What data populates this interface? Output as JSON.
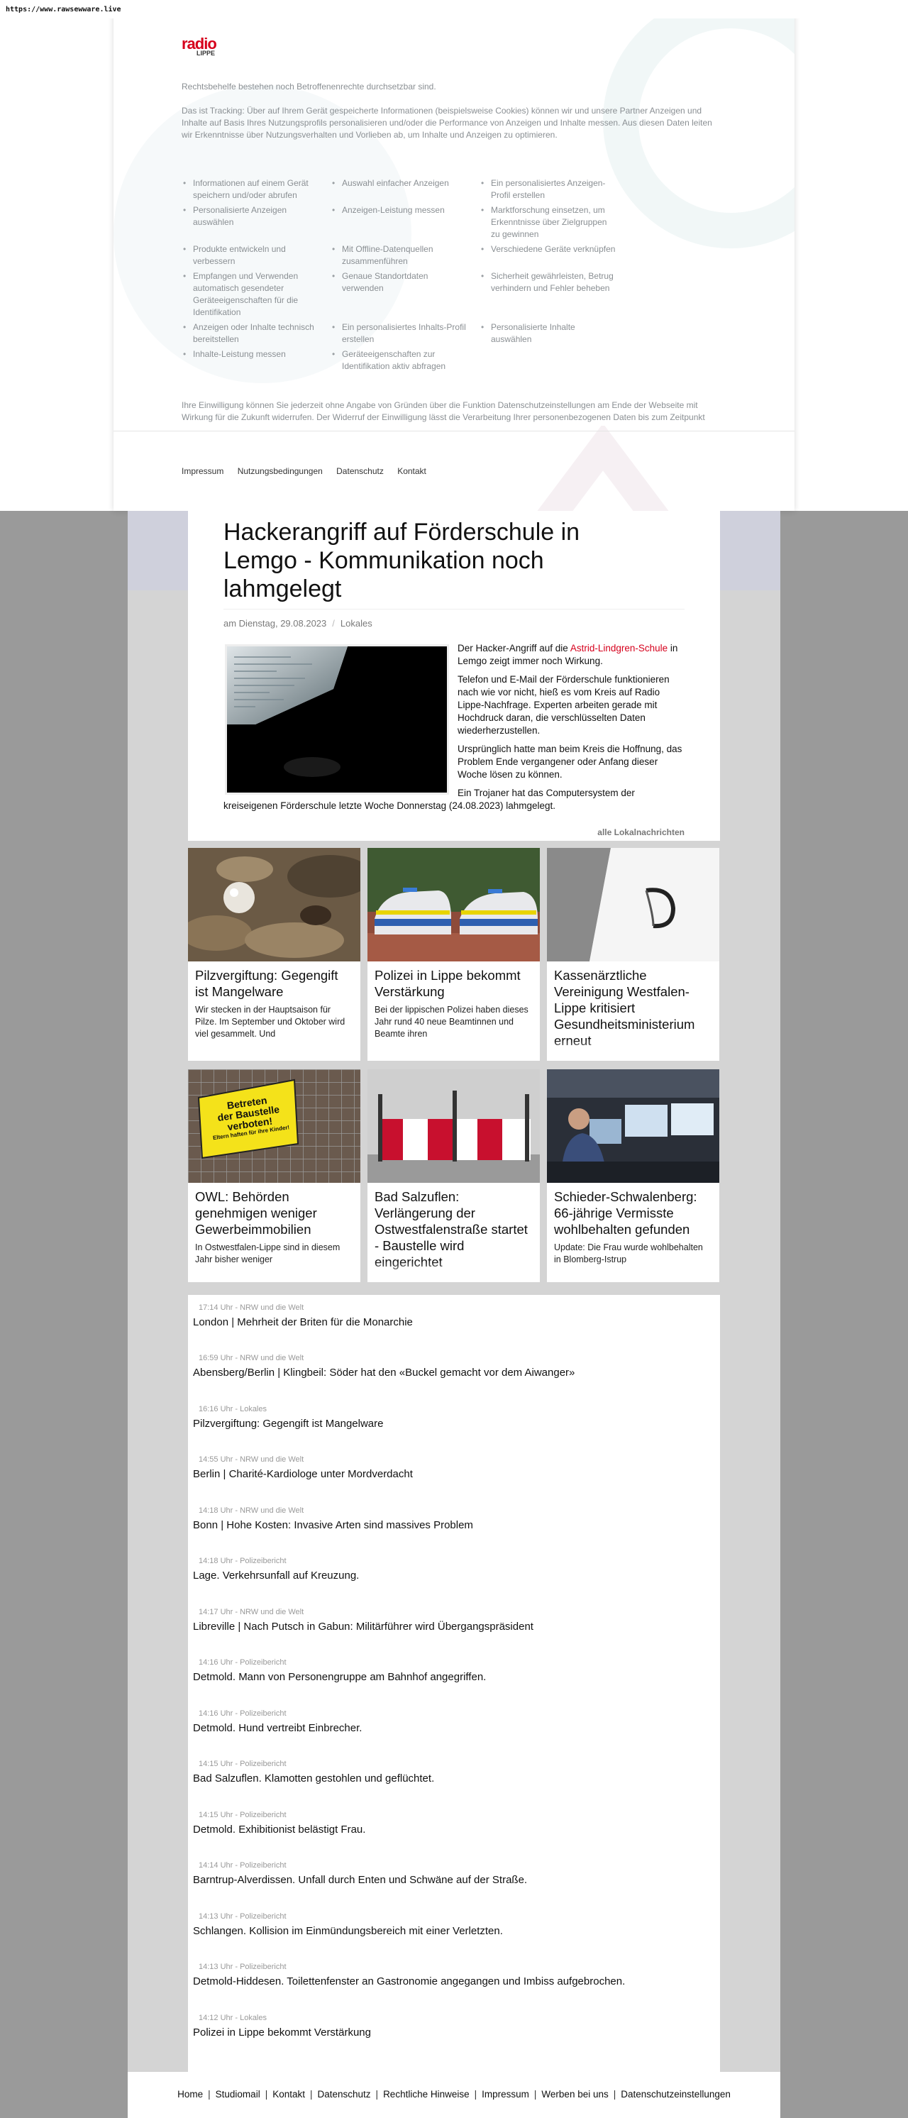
{
  "url": "https://www.rawsewware.live",
  "consent": {
    "logo_top": "radio",
    "logo_bottom": "LIPPE",
    "text1": "Rechtsbehelfe bestehen noch Betroffenenrechte durchsetzbar sind.",
    "text2": "Das ist Tracking: Über auf Ihrem Gerät gespeicherte Informationen (beispielsweise Cookies) können wir und unsere Partner Anzeigen und Inhalte auf Basis Ihres Nutzungsprofils personalisieren und/oder die Performance von Anzeigen und Inhalte messen. Aus diesen Daten leiten wir Erkenntnisse über Nutzungsverhalten und Vorlieben ab, um Inhalte und Anzeigen zu optimieren.",
    "purposes": [
      "Informationen auf einem Gerät speichern und/oder abrufen",
      "Auswahl einfacher Anzeigen",
      "Ein personalisiertes Anzeigen-Profil erstellen",
      "Personalisierte Anzeigen auswählen",
      "Anzeigen-Leistung messen",
      "Marktforschung einsetzen, um Erkenntnisse über Zielgruppen zu gewinnen",
      "Produkte entwickeln und verbessern",
      "Mit Offline-Datenquellen zusammenführen",
      "Verschiedene Geräte verknüpfen",
      "Empfangen und Verwenden automatisch gesendeter Geräteeigenschaften für die Identifikation",
      "Genaue Standortdaten verwenden",
      "Sicherheit gewährleisten, Betrug verhindern und Fehler beheben",
      "Anzeigen oder Inhalte technisch bereitstellen",
      "Ein personalisiertes Inhalts-Profil erstellen",
      "Personalisierte Inhalte auswählen",
      "Inhalte-Leistung messen",
      "Geräteeigenschaften zur Identifikation aktiv abfragen"
    ],
    "text3": "Ihre Einwilligung können Sie jederzeit ohne Angabe von Gründen über die Funktion Datenschutzeinstellungen am Ende der Webseite mit Wirkung für die Zukunft widerrufen. Der Widerruf der Einwilligung lässt die Verarbeitung Ihrer personenbezogenen Daten bis zum Zeitpunkt des Widerrufs unberührt.",
    "footer_links": [
      "Impressum",
      "Nutzungsbedingungen",
      "Datenschutz",
      "Kontakt"
    ]
  },
  "article": {
    "title": "Hackerangriff auf Förderschule in Lemgo - Kommunikation noch lahmgelegt",
    "date": "am Dienstag, 29.08.2023",
    "category": "Lokales",
    "p1_before": "Der Hacker-Angriff auf die ",
    "p1_link": "Astrid-Lindgren-Schule",
    "p1_after": " in Lemgo zeigt immer noch Wirkung.",
    "p2": "Telefon und E-Mail der Förderschule funktionieren nach wie vor nicht, hieß es vom Kreis auf Radio Lippe-Nachfrage. Experten arbeiten gerade mit Hochdruck daran, die verschlüsselten Daten wiederherzustellen.",
    "p3": "Ursprünglich hatte man beim Kreis die Hoffnung, das Problem Ende vergangener oder Anfang dieser Woche lösen zu können.",
    "p4": "Ein Trojaner hat das Computersystem der kreiseigenen Förderschule letzte Woche Donnerstag (24.08.2023) lahmgelegt.",
    "all_news": "alle Lokalnachrichten"
  },
  "cards": [
    {
      "title": "Pilzvergiftung: Gegengift ist Mangelware",
      "teaser": "Wir stecken in der Hauptsaison für Pilze. Im September und Oktober wird viel gesammelt. Und"
    },
    {
      "title": "Polizei in Lippe bekommt Verstärkung",
      "teaser": "Bei der lippischen Polizei haben dieses Jahr rund 40 neue Beamtinnen und Beamte ihren"
    },
    {
      "title": "Kassenärztliche Vereinigung Westfalen-Lippe kritisiert Gesundheitsministerium erneut",
      "teaser": ""
    },
    {
      "title": "OWL: Behörden genehmigen weniger Gewerbeimmobilien",
      "teaser": "In Ostwestfalen-Lippe sind in diesem Jahr bisher weniger"
    },
    {
      "title": "Bad Salzuflen: Verlängerung der Ostwestfalenstraße startet - Baustelle wird eingerichtet",
      "teaser": ""
    },
    {
      "title": "Schieder-Schwalenberg: 66-jährige Vermisste wohlbehalten gefunden",
      "teaser": "Update: Die Frau wurde wohlbehalten in Blomberg-Istrup"
    }
  ],
  "sign_text": {
    "line1": "Betreten",
    "line2": "der Baustelle",
    "line3": "verboten!",
    "line4": "Eltern haften für ihre Kinder!"
  },
  "news": [
    {
      "time": "17:14 Uhr - NRW und die Welt",
      "headline": "London | Mehrheit der Briten für die Monarchie"
    },
    {
      "time": "16:59 Uhr - NRW und die Welt",
      "headline": "Abensberg/Berlin | Klingbeil: Söder hat den «Buckel gemacht vor dem Aiwanger»"
    },
    {
      "time": "16:16 Uhr - Lokales",
      "headline": "Pilzvergiftung: Gegengift ist Mangelware"
    },
    {
      "time": "14:55 Uhr - NRW und die Welt",
      "headline": "Berlin | Charité-Kardiologe unter Mordverdacht"
    },
    {
      "time": "14:18 Uhr - NRW und die Welt",
      "headline": "Bonn | Hohe Kosten: Invasive Arten sind massives Problem"
    },
    {
      "time": "14:18 Uhr - Polizeibericht",
      "headline": "Lage. Verkehrsunfall auf Kreuzung."
    },
    {
      "time": "14:17 Uhr - NRW und die Welt",
      "headline": "Libreville | Nach Putsch in Gabun: Militärführer wird Übergangspräsident"
    },
    {
      "time": "14:16 Uhr - Polizeibericht",
      "headline": "Detmold. Mann von Personengruppe am Bahnhof angegriffen."
    },
    {
      "time": "14:16 Uhr - Polizeibericht",
      "headline": "Detmold. Hund vertreibt Einbrecher."
    },
    {
      "time": "14:15 Uhr - Polizeibericht",
      "headline": "Bad Salzuflen. Klamotten gestohlen und geflüchtet."
    },
    {
      "time": "14:15 Uhr - Polizeibericht",
      "headline": "Detmold. Exhibitionist belästigt Frau."
    },
    {
      "time": "14:14 Uhr - Polizeibericht",
      "headline": "Barntrup-Alverdissen. Unfall durch Enten und Schwäne auf der Straße."
    },
    {
      "time": "14:13 Uhr - Polizeibericht",
      "headline": "Schlangen. Kollision im Einmündungsbereich mit einer Verletzten."
    },
    {
      "time": "14:13 Uhr - Polizeibericht",
      "headline": "Detmold-Hiddesen. Toilettenfenster an Gastronomie angegangen und Imbiss aufgebrochen."
    },
    {
      "time": "14:12 Uhr - Lokales",
      "headline": "Polizei in Lippe bekommt Verstärkung"
    }
  ],
  "footer_links": [
    "Home",
    "Studiomail",
    "Kontakt",
    "Datenschutz",
    "Rechtliche Hinweise",
    "Impressum",
    "Werben bei uns",
    "Datenschutzeinstellungen"
  ],
  "colors": {
    "accent": "#d6001c",
    "page_bg": "#9a9a9a",
    "content_bg": "#ffffff"
  }
}
